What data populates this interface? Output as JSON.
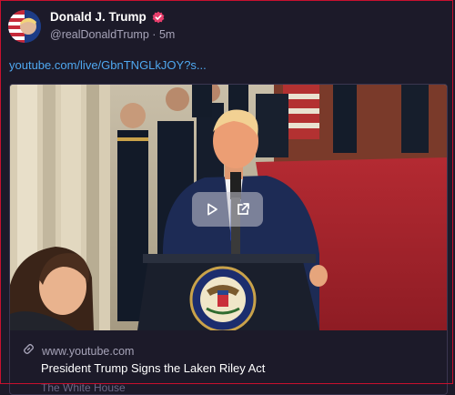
{
  "post": {
    "author_name": "Donald J. Trump",
    "handle": "@realDonaldTrump",
    "separator": "·",
    "time_ago": "5m",
    "link_text": "youtube.com/live/GbnTNGLkJOY?s..."
  },
  "card": {
    "domain": "www.youtube.com",
    "title": "President Trump Signs the Laken Riley Act",
    "source": "The White House",
    "seal_text": "SEAL OF THE PRESIDENT OF THE UNITED STATES"
  },
  "icons": {
    "verified": "verified-badge-icon",
    "play": "play-icon",
    "share": "external-link-icon",
    "link": "link-chain-icon"
  },
  "colors": {
    "background": "#1c1a29",
    "link": "#4fa8f0",
    "verified": "#e83e6c",
    "border": "#c8102e"
  }
}
